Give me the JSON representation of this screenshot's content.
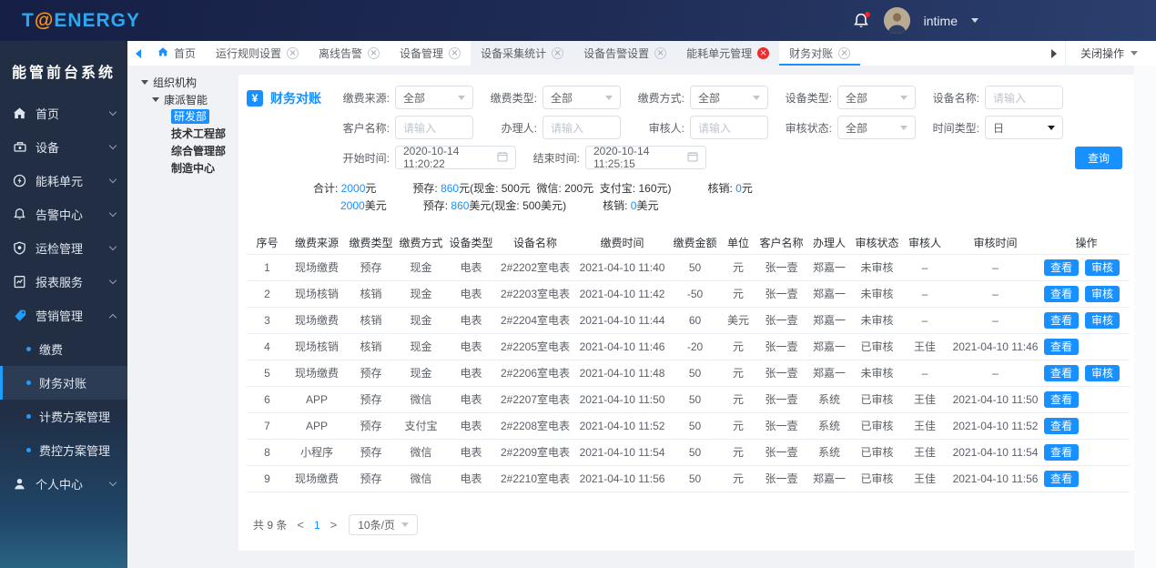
{
  "colors": {
    "accent": "#1890ff",
    "header_bg": "#1d2a52",
    "sidebar_bg": "#212e44",
    "content_bg": "#f0f2f5",
    "tab_close_alert": "#f12a2a",
    "notify_dot": "#f5222d",
    "marketing_icon_blue": "#1e9fff"
  },
  "brand": {
    "logo_pre": "T",
    "logo_at": "@",
    "logo_post": "ENERGY",
    "system_title": "能管前台系统"
  },
  "header": {
    "username": "intime"
  },
  "sidebar": {
    "items": [
      {
        "label": "首页",
        "icon": "home",
        "chevron": "down"
      },
      {
        "label": "设备",
        "icon": "device",
        "chevron": "down"
      },
      {
        "label": "能耗单元",
        "icon": "energy",
        "chevron": "down"
      },
      {
        "label": "告警中心",
        "icon": "alarm",
        "chevron": "down"
      },
      {
        "label": "运检管理",
        "icon": "inspection",
        "chevron": "down"
      },
      {
        "label": "报表服务",
        "icon": "report",
        "chevron": "down"
      },
      {
        "label": "营销管理",
        "icon": "marketing",
        "chevron": "up",
        "expanded": true,
        "children": [
          {
            "label": "缴费"
          },
          {
            "label": "财务对账",
            "active": true
          },
          {
            "label": "计费方案管理"
          },
          {
            "label": "费控方案管理"
          }
        ]
      },
      {
        "label": "个人中心",
        "icon": "user",
        "chevron": "down"
      }
    ]
  },
  "tabbar": {
    "close_menu_label": "关闭操作",
    "tabs": [
      {
        "label": "首页",
        "home": true
      },
      {
        "label": "运行规则设置",
        "closable": true
      },
      {
        "label": "离线告警",
        "closable": true
      },
      {
        "label": "设备管理",
        "closable": true
      },
      {
        "label": "设备采集统计",
        "closable": true,
        "shaded": true
      },
      {
        "label": "设备告警设置",
        "closable": true,
        "shaded": true
      },
      {
        "label": "能耗单元管理",
        "closable": true,
        "close_red": true,
        "shaded": true
      },
      {
        "label": "财务对账",
        "closable": true,
        "active": true
      }
    ]
  },
  "tree": {
    "root": "组织机构",
    "company": "康派智能",
    "departments": [
      {
        "label": "研发部",
        "active": true
      },
      {
        "label": "技术工程部"
      },
      {
        "label": "综合管理部"
      },
      {
        "label": "制造中心"
      }
    ]
  },
  "page": {
    "title": "财务对账"
  },
  "filters": {
    "query_label": "查询",
    "rows": [
      [
        {
          "label": "缴费来源:",
          "type": "select",
          "value": "全部"
        },
        {
          "label": "缴费类型:",
          "type": "select",
          "value": "全部"
        },
        {
          "label": "缴费方式:",
          "type": "select",
          "value": "全部"
        },
        {
          "label": "设备类型:",
          "type": "select",
          "value": "全部"
        },
        {
          "label": "设备名称:",
          "type": "input",
          "placeholder": "请输入"
        }
      ],
      [
        {
          "label": "客户名称:",
          "type": "input",
          "placeholder": "请输入"
        },
        {
          "label": "办理人:",
          "type": "input",
          "placeholder": "请输入"
        },
        {
          "label": "审核人:",
          "type": "input",
          "placeholder": "请输入"
        },
        {
          "label": "审核状态:",
          "type": "select",
          "value": "全部"
        },
        {
          "label": "时间类型:",
          "type": "select-native",
          "value": "日"
        }
      ],
      [
        {
          "label": "开始时间:",
          "type": "date",
          "value": "2020-10-14 11:20:22"
        },
        {
          "label": "结束时间:",
          "type": "date",
          "value": "2020-10-14 11:25:15"
        }
      ]
    ]
  },
  "summary": {
    "line1": [
      {
        "label": "合计: ",
        "num": "2000",
        "rest": "元"
      },
      {
        "label": "预存: ",
        "num": "860",
        "rest": "元(现金: 500元  微信: 200元  支付宝: 160元)"
      },
      {
        "label": "核销: ",
        "num": "0",
        "rest": "元"
      }
    ],
    "line2": [
      {
        "label": "",
        "num": "2000",
        "rest": "美元"
      },
      {
        "label": "预存: ",
        "num": "860",
        "rest": "美元(现金: 500美元)"
      },
      {
        "label": "核销: ",
        "num": "0",
        "rest": "美元"
      }
    ]
  },
  "table": {
    "columns": [
      "序号",
      "缴费来源",
      "缴费类型",
      "缴费方式",
      "设备类型",
      "设备名称",
      "缴费时间",
      "缴费金额",
      "单位",
      "客户名称",
      "办理人",
      "审核状态",
      "审核人",
      "审核时间",
      "操作"
    ],
    "action_labels": {
      "view": "查看",
      "audit": "审核"
    },
    "rows": [
      {
        "seq": "1",
        "source": "现场缴费",
        "pay_type": "预存",
        "method": "现金",
        "device_type": "电表",
        "device_name": "2#2202室电表",
        "pay_time": "2021-04-10 11:40",
        "amount": "50",
        "unit": "元",
        "customer": "张一壹",
        "handler": "郑嘉一",
        "status": "未审核",
        "auditor": "–",
        "audit_time": "–",
        "can_audit": true
      },
      {
        "seq": "2",
        "source": "现场核销",
        "pay_type": "核销",
        "method": "现金",
        "device_type": "电表",
        "device_name": "2#2203室电表",
        "pay_time": "2021-04-10 11:42",
        "amount": "-50",
        "unit": "元",
        "customer": "张一壹",
        "handler": "郑嘉一",
        "status": "未审核",
        "auditor": "–",
        "audit_time": "–",
        "can_audit": true
      },
      {
        "seq": "3",
        "source": "现场缴费",
        "pay_type": "核销",
        "method": "现金",
        "device_type": "电表",
        "device_name": "2#2204室电表",
        "pay_time": "2021-04-10 11:44",
        "amount": "60",
        "unit": "美元",
        "customer": "张一壹",
        "handler": "郑嘉一",
        "status": "未审核",
        "auditor": "–",
        "audit_time": "–",
        "can_audit": true
      },
      {
        "seq": "4",
        "source": "现场核销",
        "pay_type": "核销",
        "method": "现金",
        "device_type": "电表",
        "device_name": "2#2205室电表",
        "pay_time": "2021-04-10 11:46",
        "amount": "-20",
        "unit": "元",
        "customer": "张一壹",
        "handler": "郑嘉一",
        "status": "已审核",
        "auditor": "王佳",
        "audit_time": "2021-04-10 11:46",
        "can_audit": false
      },
      {
        "seq": "5",
        "source": "现场缴费",
        "pay_type": "预存",
        "method": "现金",
        "device_type": "电表",
        "device_name": "2#2206室电表",
        "pay_time": "2021-04-10 11:48",
        "amount": "50",
        "unit": "元",
        "customer": "张一壹",
        "handler": "郑嘉一",
        "status": "未审核",
        "auditor": "–",
        "audit_time": "–",
        "can_audit": true
      },
      {
        "seq": "6",
        "source": "APP",
        "pay_type": "预存",
        "method": "微信",
        "device_type": "电表",
        "device_name": "2#2207室电表",
        "pay_time": "2021-04-10 11:50",
        "amount": "50",
        "unit": "元",
        "customer": "张一壹",
        "handler": "系统",
        "status": "已审核",
        "auditor": "王佳",
        "audit_time": "2021-04-10 11:50",
        "can_audit": false
      },
      {
        "seq": "7",
        "source": "APP",
        "pay_type": "预存",
        "method": "支付宝",
        "device_type": "电表",
        "device_name": "2#2208室电表",
        "pay_time": "2021-04-10 11:52",
        "amount": "50",
        "unit": "元",
        "customer": "张一壹",
        "handler": "系统",
        "status": "已审核",
        "auditor": "王佳",
        "audit_time": "2021-04-10 11:52",
        "can_audit": false
      },
      {
        "seq": "8",
        "source": "小程序",
        "pay_type": "预存",
        "method": "微信",
        "device_type": "电表",
        "device_name": "2#2209室电表",
        "pay_time": "2021-04-10 11:54",
        "amount": "50",
        "unit": "元",
        "customer": "张一壹",
        "handler": "系统",
        "status": "已审核",
        "auditor": "王佳",
        "audit_time": "2021-04-10 11:54",
        "can_audit": false
      },
      {
        "seq": "9",
        "source": "现场缴费",
        "pay_type": "预存",
        "method": "微信",
        "device_type": "电表",
        "device_name": "2#2210室电表",
        "pay_time": "2021-04-10 11:56",
        "amount": "50",
        "unit": "元",
        "customer": "张一壹",
        "handler": "郑嘉一",
        "status": "已审核",
        "auditor": "王佳",
        "audit_time": "2021-04-10 11:56",
        "can_audit": false
      }
    ]
  },
  "pagination": {
    "total": "共 9 条",
    "prev": "<",
    "page": "1",
    "next": ">",
    "page_size": "10条/页"
  }
}
